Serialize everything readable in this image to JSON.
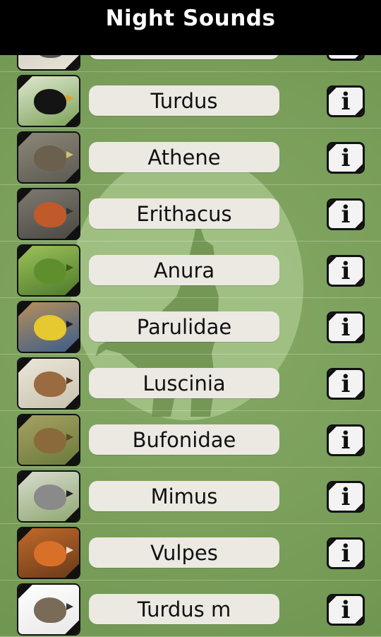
{
  "app": {
    "title": "Night Sounds"
  },
  "info_glyph": "i",
  "animals": [
    {
      "name": "Turdus",
      "thumb": {
        "bg1": "#7da35a",
        "bg2": "#dfe7d0",
        "body": "#141414",
        "beak": "#e3a020"
      }
    },
    {
      "name": "Athene",
      "thumb": {
        "bg1": "#5b5a52",
        "bg2": "#8c8878",
        "body": "#6b5f4d",
        "beak": "#d8c070"
      }
    },
    {
      "name": "Erithacus",
      "thumb": {
        "bg1": "#4a4842",
        "bg2": "#7e7a70",
        "body": "#c05a2a",
        "beak": "#333333"
      }
    },
    {
      "name": "Anura",
      "thumb": {
        "bg1": "#4f7a2a",
        "bg2": "#9cc25a",
        "body": "#5f8f2d",
        "beak": "#3a5a1a"
      }
    },
    {
      "name": "Parulidae",
      "thumb": {
        "bg1": "#3a5d8a",
        "bg2": "#b88f5a",
        "body": "#e6c830",
        "beak": "#222222"
      }
    },
    {
      "name": "Luscinia",
      "thumb": {
        "bg1": "#c9c2b0",
        "bg2": "#ebe6d8",
        "body": "#9a6a40",
        "beak": "#5a3a20"
      }
    },
    {
      "name": "Bufonidae",
      "thumb": {
        "bg1": "#6a7a3a",
        "bg2": "#a6a262",
        "body": "#8a6a3a",
        "beak": "#5a4a2a"
      }
    },
    {
      "name": "Mimus",
      "thumb": {
        "bg1": "#8fa870",
        "bg2": "#d8dcd0",
        "body": "#8a8a8a",
        "beak": "#222222"
      }
    },
    {
      "name": "Vulpes",
      "thumb": {
        "bg1": "#6a3a1a",
        "bg2": "#c06a2a",
        "body": "#d8702a",
        "beak": "#f0e0d0"
      }
    },
    {
      "name": "Turdus m",
      "thumb": {
        "bg1": "#e8e8e8",
        "bg2": "#ffffff",
        "body": "#7a6a58",
        "beak": "#333333"
      }
    }
  ],
  "partial_top_row": {
    "thumb": {
      "bg1": "#e8e4d8",
      "bg2": "#c9c5b8",
      "body": "#555555",
      "beak": "#333333"
    }
  }
}
